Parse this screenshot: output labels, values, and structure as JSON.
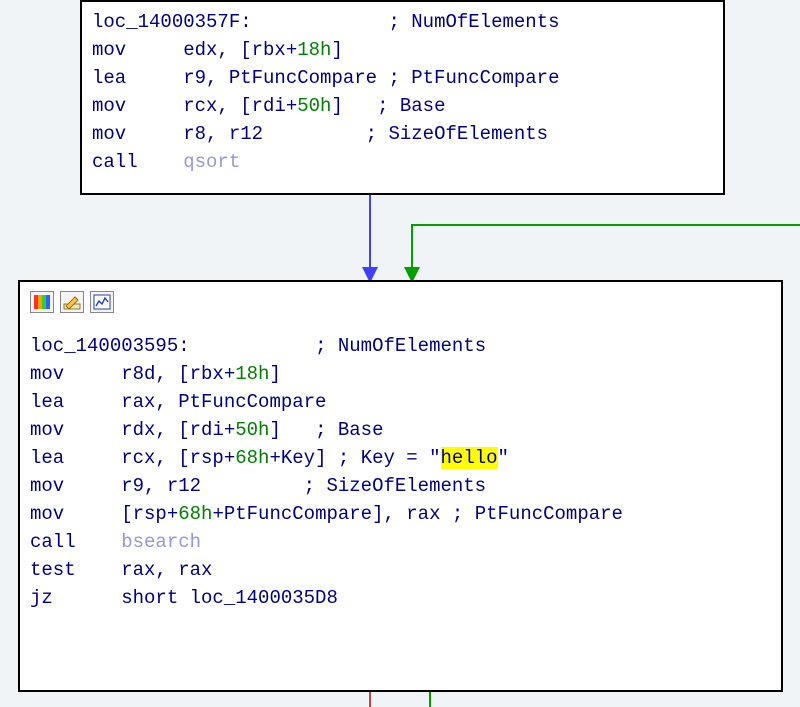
{
  "block1": {
    "label": "loc_14000357F:",
    "label_comment": "; NumOfElements",
    "lines": [
      {
        "mn": "mov",
        "ops_pre": "edx, [rbx+",
        "num": "18h",
        "ops_post": "]",
        "comment": ""
      },
      {
        "mn": "lea",
        "ops_pre": "r9, PtFuncCompare ",
        "num": "",
        "ops_post": "",
        "comment": "; PtFuncCompare"
      },
      {
        "mn": "mov",
        "ops_pre": "rcx, [rdi+",
        "num": "50h",
        "ops_post": "]   ",
        "comment": "; Base"
      },
      {
        "mn": "mov",
        "ops_pre": "r8, r12         ",
        "num": "",
        "ops_post": "",
        "comment": "; SizeOfElements"
      },
      {
        "mn": "call",
        "target": "qsort"
      }
    ]
  },
  "block2": {
    "label": "loc_140003595:",
    "label_comment": "; NumOfElements",
    "lines": [
      {
        "mn": "mov",
        "ops_pre": "r8d, [rbx+",
        "num": "18h",
        "ops_post": "]",
        "comment": ""
      },
      {
        "mn": "lea",
        "ops_pre": "rax, PtFuncCompare",
        "num": "",
        "ops_post": "",
        "comment": ""
      },
      {
        "mn": "mov",
        "ops_pre": "rdx, [rdi+",
        "num": "50h",
        "ops_post": "]   ",
        "comment": "; Base"
      },
      {
        "mn": "lea",
        "ops_pre": "rcx, [rsp+",
        "num": "68h",
        "ops_post": "+Key] ",
        "comment": "; Key = \"",
        "hl": "hello",
        "comment2": "\""
      },
      {
        "mn": "mov",
        "ops_pre": "r9, r12         ",
        "num": "",
        "ops_post": "",
        "comment": "; SizeOfElements"
      },
      {
        "mn": "mov",
        "ops_pre": "[rsp+",
        "num": "68h",
        "ops_post": "+PtFuncCompare], rax ",
        "comment": "; PtFuncCompare"
      },
      {
        "mn": "call",
        "target": "bsearch"
      },
      {
        "mn": "test",
        "ops_pre": "rax, rax",
        "num": "",
        "ops_post": "",
        "comment": ""
      },
      {
        "mn": "jz",
        "ops_pre": "short loc_1400035D8",
        "num": "",
        "ops_post": "",
        "comment": ""
      }
    ]
  },
  "arrows": {
    "blue_color": "#4040ff",
    "green_color": "#00a000",
    "red_color": "#d04040"
  }
}
